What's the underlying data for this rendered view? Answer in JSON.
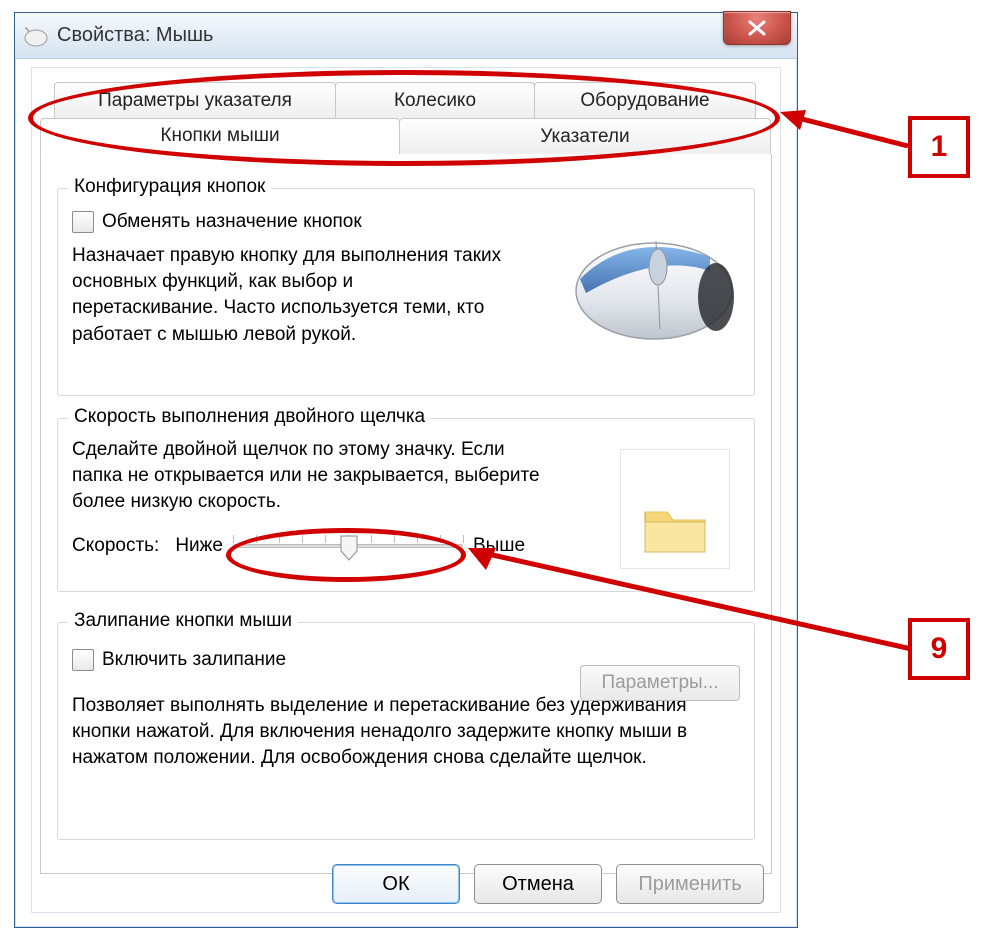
{
  "window": {
    "title": "Свойства: Мышь"
  },
  "tabs": {
    "row1": [
      "Параметры указателя",
      "Колесико",
      "Оборудование"
    ],
    "row2": [
      "Кнопки мыши",
      "Указатели"
    ]
  },
  "group_buttons": {
    "title": "Конфигурация кнопок",
    "swap_label": "Обменять назначение кнопок",
    "desc": "Назначает правую кнопку для выполнения таких основных функций, как выбор и перетаскивание. Часто используется теми, кто работает с мышью левой рукой."
  },
  "group_speed": {
    "title": "Скорость выполнения двойного щелчка",
    "desc": "Сделайте двойной щелчок по этому значку. Если папка не открывается или не закрывается, выберите более низкую скорость.",
    "label": "Скорость:",
    "min": "Ниже",
    "max": "Выше"
  },
  "group_clicklock": {
    "title": "Залипание кнопки мыши",
    "enable_label": "Включить залипание",
    "params_btn": "Параметры...",
    "desc": "Позволяет выполнять выделение и перетаскивание без удерживания кнопки нажатой. Для включения ненадолго задержите кнопку мыши в нажатом положении. Для освобождения снова сделайте щелчок."
  },
  "actions": {
    "ok": "ОК",
    "cancel": "Отмена",
    "apply": "Применить"
  },
  "annotations": {
    "callout1": "1",
    "callout9": "9"
  }
}
